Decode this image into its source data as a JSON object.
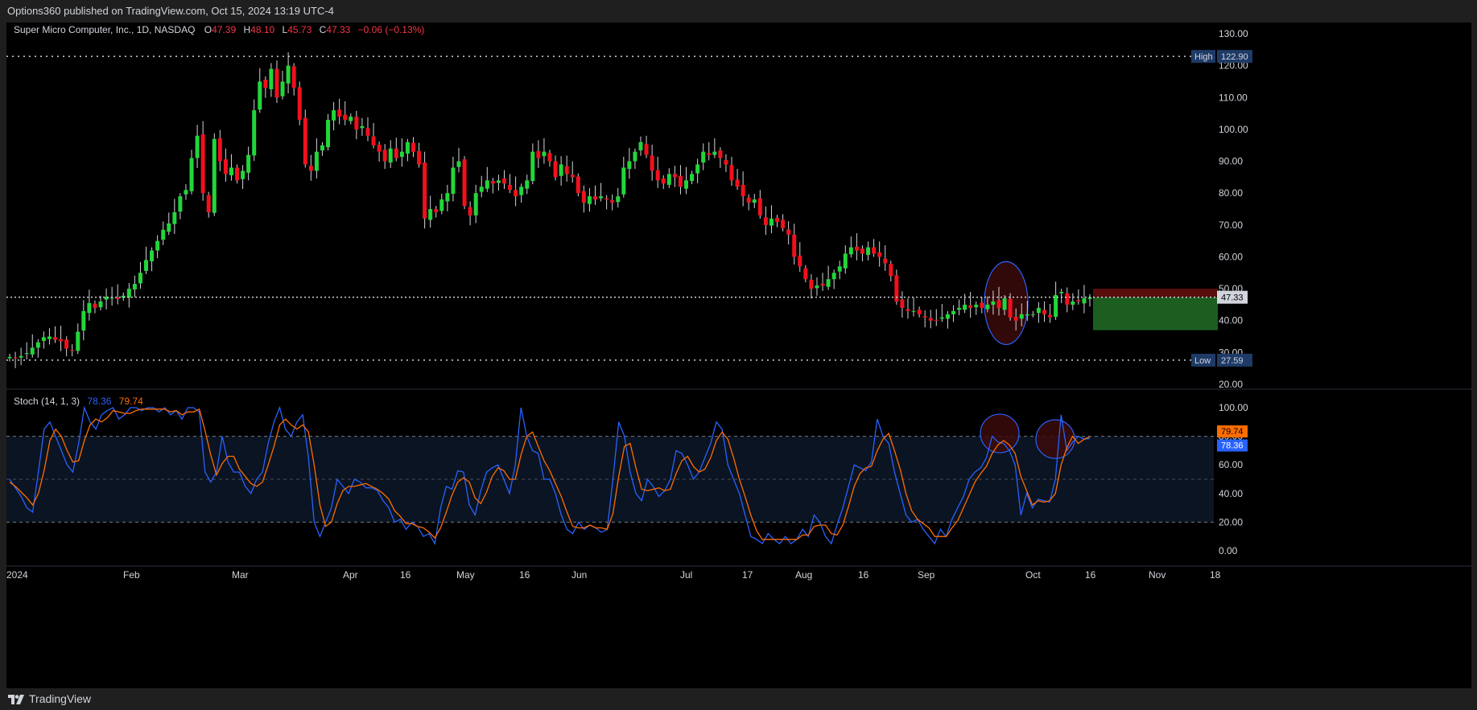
{
  "header": {
    "publisher_line": "Options360 published on TradingView.com, Oct 15, 2024 13:19 UTC-4"
  },
  "footer": {
    "brand": "TradingView"
  },
  "legend": {
    "symbol": "Super Micro Computer, Inc., 1D, NASDAQ",
    "o_label": "O",
    "o_value": "47.39",
    "h_label": "H",
    "h_value": "48.10",
    "l_label": "L",
    "l_value": "45.73",
    "c_label": "C",
    "c_value": "47.33",
    "change": "−0.06 (−0.13%)"
  },
  "stoch_legend": {
    "name": "Stoch (14, 1, 3)",
    "k_value": "78.36",
    "d_value": "79.74"
  },
  "colors": {
    "up": "#22d63a",
    "down": "#f2101c",
    "k_line": "#2962ff",
    "d_line": "#ff6d00",
    "band_fill": "#0b1422",
    "target_zone": "#1b5e20",
    "stop_zone": "#5a0d0d",
    "circle_stroke": "#2962ff",
    "circle_fill": "#3a0a0a"
  },
  "chart_data": [
    {
      "type": "candlestick",
      "title": "Super Micro Computer, Inc., 1D, NASDAQ",
      "ylim": [
        20,
        130
      ],
      "y_ticks": [
        "130.00",
        "120.00",
        "110.00",
        "100.00",
        "90.00",
        "80.00",
        "70.00",
        "60.00",
        "50.00",
        "40.00",
        "30.00",
        "20.00"
      ],
      "x_labels": [
        "2024",
        "Feb",
        "Mar",
        "Apr",
        "16",
        "May",
        "16",
        "Jun",
        "Jul",
        "17",
        "Aug",
        "16",
        "Sep",
        "Oct",
        "16",
        "Nov",
        "18"
      ],
      "high_label": "High",
      "high_value": "122.90",
      "low_label": "Low",
      "low_value": "27.59",
      "last_price": "47.33",
      "closes": [
        28.6,
        28.2,
        28.9,
        29.8,
        31.5,
        33.2,
        34.8,
        35.0,
        34.0,
        33.5,
        31.2,
        30.5,
        36.5,
        43.0,
        45.5,
        44.0,
        46.0,
        47.5,
        47.2,
        46.8,
        47.8,
        50.0,
        51.5,
        55.0,
        59.0,
        62.0,
        65.0,
        68.5,
        70.5,
        74.0,
        79.0,
        81.0,
        91.0,
        98.0,
        80.0,
        74.0,
        97.0,
        90.0,
        86.0,
        88.0,
        84.0,
        87.0,
        92.0,
        106.0,
        115.0,
        113.0,
        119.0,
        110.0,
        115.0,
        120.0,
        113.0,
        103.0,
        89.0,
        87.0,
        93.0,
        95.0,
        103.0,
        106.0,
        104.0,
        103.0,
        104.0,
        100.0,
        101.0,
        98.0,
        95.0,
        93.0,
        90.0,
        94.0,
        91.0,
        93.0,
        96.0,
        93.0,
        89.0,
        72.0,
        75.0,
        74.0,
        78.0,
        80.0,
        88.0,
        90.0,
        76.0,
        73.0,
        80.0,
        82.0,
        84.0,
        83.0,
        84.0,
        83.0,
        81.0,
        79.0,
        82.0,
        84.0,
        93.0,
        91.0,
        93.0,
        90.0,
        85.0,
        89.0,
        86.0,
        85.0,
        80.0,
        77.0,
        79.0,
        78.0,
        79.0,
        78.0,
        77.0,
        79.0,
        88.0,
        90.0,
        93.0,
        96.0,
        92.0,
        87.0,
        84.0,
        83.0,
        86.0,
        85.0,
        82.0,
        84.0,
        86.0,
        89.0,
        93.0,
        92.0,
        93.0,
        91.0,
        89.0,
        84.0,
        82.0,
        79.0,
        77.0,
        78.0,
        73.0,
        70.0,
        72.0,
        71.0,
        69.0,
        67.0,
        60.0,
        57.0,
        53.0,
        50.0,
        51.0,
        51.0,
        53.0,
        55.0,
        57.0,
        61.0,
        63.0,
        62.0,
        61.0,
        63.0,
        61.0,
        60.0,
        58.0,
        54.0,
        46.0,
        44.0,
        43.0,
        43.0,
        42.0,
        41.0,
        40.0,
        40.0,
        41.0,
        42.0,
        43.0,
        44.0,
        45.0,
        44.0,
        45.0,
        44.0,
        45.0,
        46.0,
        44.0,
        47.0,
        41.0,
        40.0,
        42.0,
        42.0,
        42.0,
        44.0,
        42.0,
        41.0,
        48.0,
        49.0,
        45.0,
        46.0,
        46.0,
        47.0,
        47.3
      ]
    },
    {
      "type": "line",
      "title": "Stoch (14, 1, 3)",
      "ylim": [
        0,
        100
      ],
      "y_ticks": [
        "100.00",
        "80.00",
        "60.00",
        "40.00",
        "20.00",
        "0.00"
      ],
      "band": [
        20,
        80
      ],
      "k_last": "78.36",
      "d_last": "79.74",
      "series": [
        {
          "name": "%K",
          "values": [
            50,
            44,
            38,
            30,
            27,
            55,
            85,
            90,
            80,
            70,
            60,
            55,
            75,
            100,
            90,
            85,
            95,
            98,
            100,
            92,
            95,
            100,
            100,
            98,
            100,
            100,
            97,
            100,
            95,
            98,
            92,
            100,
            100,
            97,
            55,
            48,
            55,
            80,
            62,
            55,
            55,
            45,
            40,
            50,
            55,
            75,
            90,
            100,
            85,
            80,
            90,
            95,
            65,
            20,
            10,
            20,
            30,
            50,
            45,
            40,
            50,
            48,
            44,
            44,
            42,
            35,
            30,
            20,
            22,
            15,
            20,
            17,
            10,
            12,
            5,
            30,
            45,
            43,
            56,
            55,
            32,
            25,
            42,
            55,
            58,
            60,
            50,
            40,
            60,
            100,
            80,
            70,
            68,
            50,
            50,
            40,
            25,
            15,
            12,
            20,
            15,
            18,
            16,
            13,
            15,
            50,
            90,
            80,
            55,
            40,
            35,
            50,
            45,
            38,
            42,
            50,
            70,
            68,
            60,
            50,
            55,
            65,
            75,
            90,
            85,
            60,
            50,
            40,
            25,
            10,
            8,
            5,
            12,
            8,
            5,
            10,
            5,
            8,
            15,
            10,
            25,
            20,
            10,
            5,
            18,
            30,
            45,
            60,
            58,
            56,
            62,
            92,
            80,
            75,
            55,
            40,
            25,
            20,
            22,
            15,
            10,
            5,
            15,
            10,
            22,
            30,
            38,
            50,
            55,
            58,
            65,
            80,
            76,
            75,
            70,
            60,
            25,
            40,
            30,
            36,
            35,
            34,
            50,
            95,
            70,
            76,
            80,
            78,
            78.4
          ]
        },
        {
          "name": "%D",
          "values": [
            48,
            45,
            41,
            37,
            32,
            40,
            56,
            77,
            85,
            80,
            70,
            62,
            63,
            77,
            88,
            92,
            90,
            93,
            98,
            97,
            96,
            96,
            98,
            99,
            99,
            99,
            99,
            99,
            97,
            98,
            95,
            97,
            97,
            99,
            84,
            67,
            53,
            61,
            66,
            66,
            57,
            52,
            47,
            45,
            48,
            60,
            73,
            88,
            92,
            88,
            85,
            88,
            83,
            60,
            32,
            17,
            20,
            33,
            42,
            45,
            45,
            46,
            47,
            45,
            43,
            40,
            36,
            28,
            24,
            19,
            19,
            17,
            16,
            13,
            9,
            16,
            27,
            39,
            48,
            51,
            48,
            37,
            33,
            41,
            52,
            58,
            56,
            50,
            50,
            67,
            80,
            83,
            73,
            63,
            56,
            47,
            38,
            27,
            17,
            16,
            16,
            18,
            16,
            16,
            15,
            26,
            52,
            73,
            75,
            58,
            43,
            42,
            43,
            44,
            42,
            43,
            54,
            63,
            66,
            59,
            55,
            57,
            65,
            77,
            83,
            78,
            65,
            50,
            38,
            25,
            14,
            8,
            8,
            8,
            8,
            8,
            8,
            8,
            11,
            11,
            17,
            18,
            18,
            12,
            11,
            18,
            31,
            45,
            54,
            58,
            59,
            70,
            78,
            82,
            70,
            57,
            40,
            28,
            22,
            19,
            16,
            10,
            10,
            10,
            16,
            21,
            30,
            39,
            48,
            54,
            59,
            68,
            74,
            77,
            74,
            68,
            52,
            42,
            32,
            35,
            34,
            35,
            40,
            60,
            72,
            80,
            75,
            78,
            79.7
          ]
        }
      ]
    }
  ]
}
